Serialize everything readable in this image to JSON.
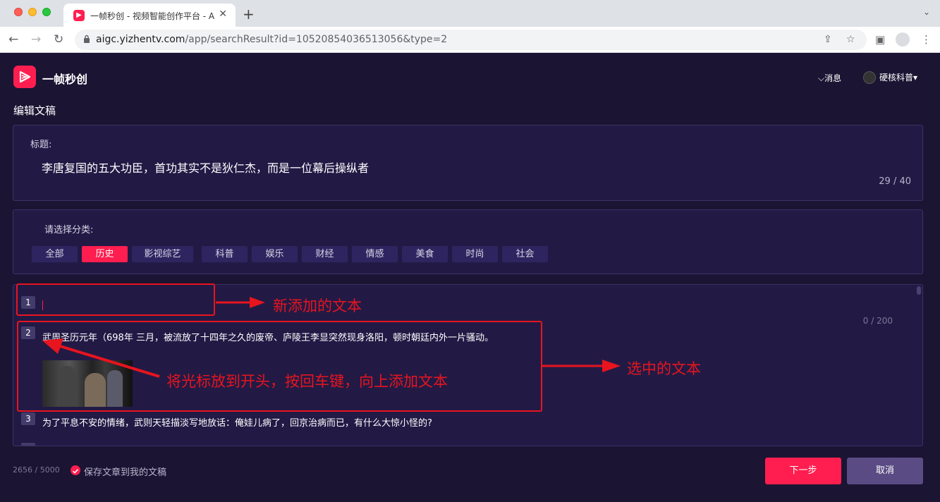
{
  "browser": {
    "tab_title": "一帧秒创 - 视频智能创作平台 - A",
    "tab_close": "✕",
    "new_tab": "+",
    "url_host": "aigc.yizhentv.com",
    "url_path": "/app/searchResult?id=10520854036513056&type=2"
  },
  "header": {
    "app_name": "一帧秒创",
    "messages_label": "⌵消息",
    "username": "硬核科普▾"
  },
  "page": {
    "title": "编辑文稿"
  },
  "title_section": {
    "label": "标题:",
    "value": "李唐复国的五大功臣，首功其实不是狄仁杰，而是一位幕后操纵者",
    "count": "29 / 40"
  },
  "category_section": {
    "label": "请选择分类:",
    "categories": [
      "全部",
      "历史",
      "影视综艺",
      "科普",
      "娱乐",
      "财经",
      "情感",
      "美食",
      "时尚",
      "社会"
    ],
    "selected": "历史"
  },
  "paragraphs": [
    {
      "num": "1",
      "text": ""
    },
    {
      "num": "2",
      "text": "武周圣历元年（698年 三月，被流放了十四年之久的废帝、庐陵王李显突然现身洛阳，顿时朝廷内外一片骚动。"
    },
    {
      "num": "3",
      "text": "为了平息不安的情绪，武则天轻描淡写地放话：俺娃儿病了，回京治病而已，有什么大惊小怪的?"
    }
  ],
  "paragraph_count": "0 / 200",
  "annotations": {
    "new_text": "新添加的文本",
    "selected_text": "选中的文本",
    "instruction": "将光标放到开头，按回车键，向上添加文本",
    "color": "#e8141e"
  },
  "footer": {
    "word_count": "2656 / 5000",
    "save_label": "保存文章到我的文稿",
    "next_button": "下一步",
    "cancel_button": "取消"
  },
  "colors": {
    "background": "#1b1433",
    "panel": "#221a45",
    "accent": "#ff1e4f",
    "cancel": "#5a4b84"
  }
}
